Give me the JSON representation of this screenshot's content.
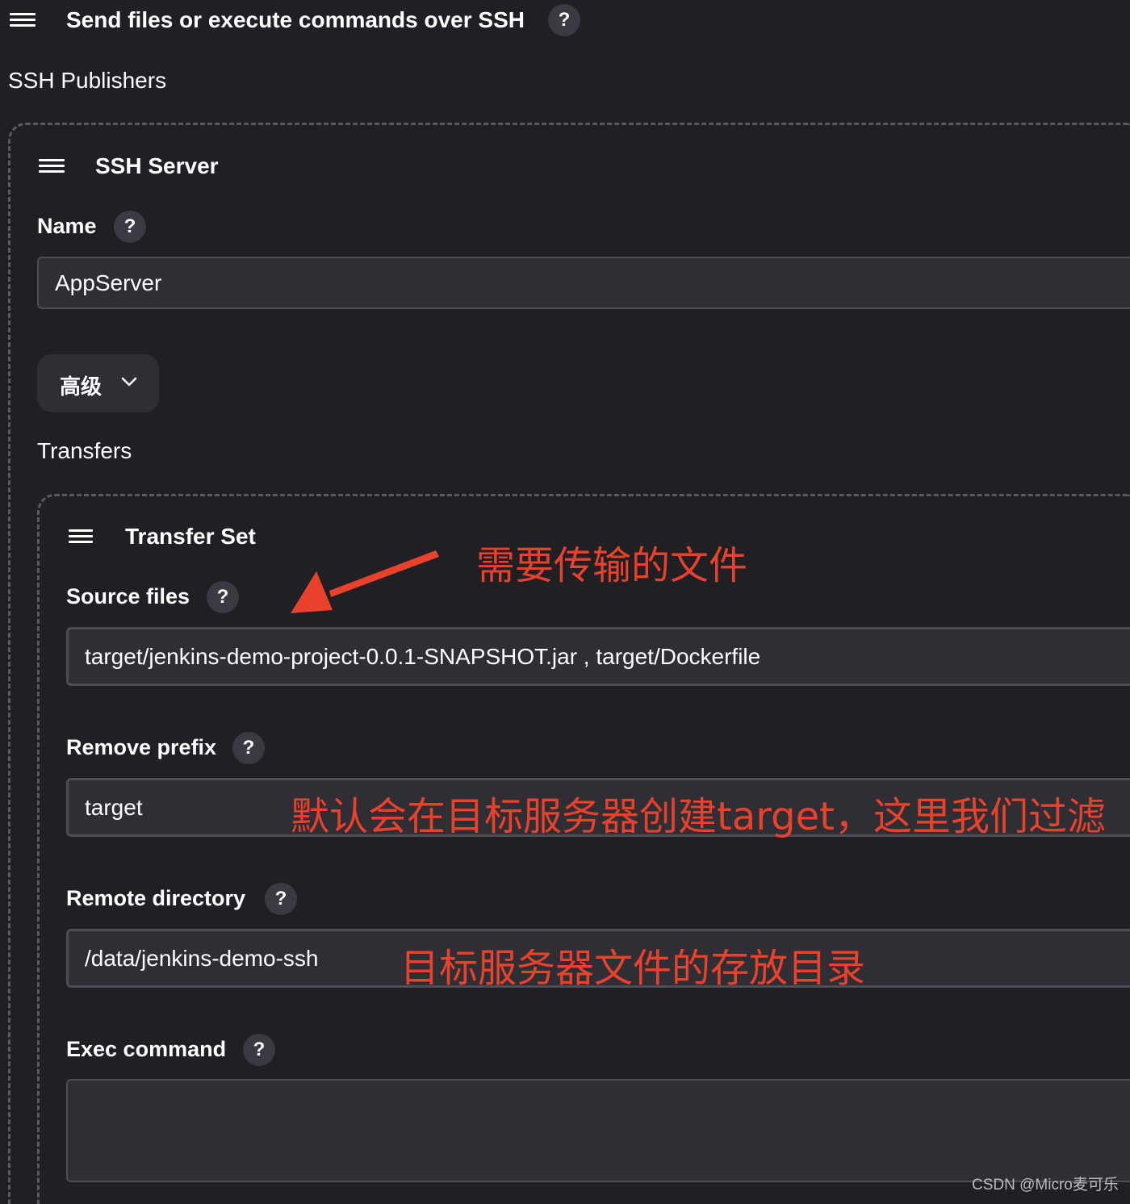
{
  "header": {
    "title": "Send files or execute commands over SSH",
    "help_label": "?"
  },
  "ssh_publishers": {
    "label": "SSH Publishers"
  },
  "ssh_server": {
    "title": "SSH Server",
    "name_label": "Name",
    "name_value": "AppServer",
    "advanced_label": "高级",
    "transfers_label": "Transfers"
  },
  "transfer_set": {
    "title": "Transfer Set",
    "source_files_label": "Source files",
    "source_files_value": "target/jenkins-demo-project-0.0.1-SNAPSHOT.jar , target/Dockerfile",
    "remove_prefix_label": "Remove prefix",
    "remove_prefix_value": "target",
    "remote_directory_label": "Remote directory",
    "remote_directory_value": "/data/jenkins-demo-ssh",
    "exec_command_label": "Exec command",
    "exec_command_value": ""
  },
  "annotations": {
    "source_files_note": "需要传输的文件",
    "remove_prefix_note": "默认会在目标服务器创建target，这里我们过滤",
    "remote_directory_note": "目标服务器文件的存放目录"
  },
  "watermark": "CSDN @Micro麦可乐",
  "colors": {
    "background": "#1f1f24",
    "input_background": "#2e2e34",
    "annotation_red": "#e8412c"
  },
  "icons": [
    "menu-icon",
    "help-icon",
    "chevron-down-icon",
    "arrow-annotation"
  ]
}
